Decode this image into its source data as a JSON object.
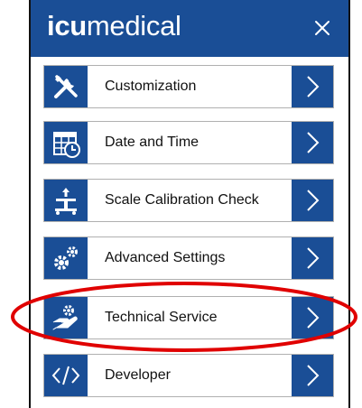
{
  "header": {
    "logo_bold": "icu",
    "logo_light": "medical",
    "close_icon": "close-icon",
    "background": "#1a4e96"
  },
  "menu": {
    "items": [
      {
        "label": "Customization",
        "icon": "tools-icon"
      },
      {
        "label": "Date and Time",
        "icon": "calendar-clock-icon"
      },
      {
        "label": "Scale Calibration Check",
        "icon": "scale-icon"
      },
      {
        "label": "Advanced Settings",
        "icon": "gears-icon"
      },
      {
        "label": "Technical Service",
        "icon": "hand-gear-icon"
      },
      {
        "label": "Developer",
        "icon": "code-icon"
      }
    ]
  },
  "annotation": {
    "highlighted_item": "Technical Service",
    "color": "#e00000"
  }
}
